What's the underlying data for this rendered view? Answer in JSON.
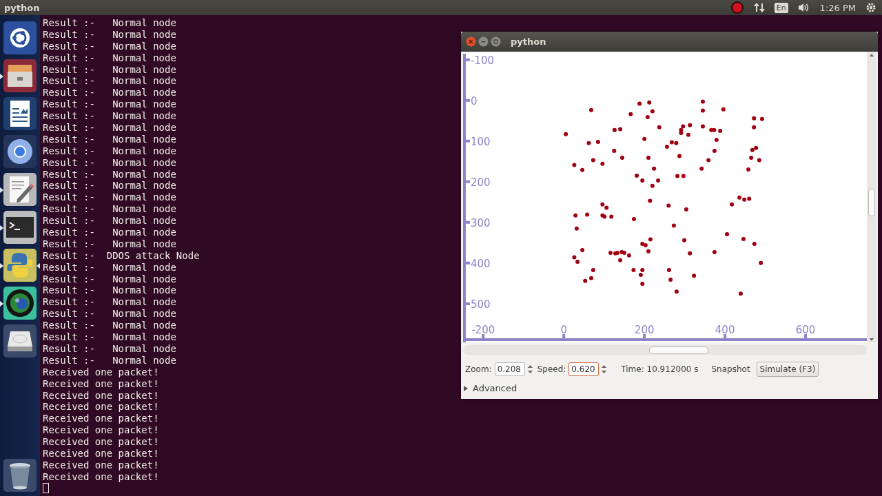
{
  "top_panel": {
    "app_title": "python",
    "keyboard_layout": "En",
    "clock": "1:26 PM"
  },
  "launcher": {
    "items": [
      {
        "kind": "dash",
        "running": false,
        "focused": false
      },
      {
        "kind": "files",
        "running": true,
        "focused": false
      },
      {
        "kind": "writer",
        "running": false,
        "focused": false
      },
      {
        "kind": "browser",
        "running": false,
        "focused": false
      },
      {
        "kind": "editor",
        "running": true,
        "focused": false
      },
      {
        "kind": "terminal",
        "running": true,
        "focused": false
      },
      {
        "kind": "python",
        "running": true,
        "focused": true
      },
      {
        "kind": "camera",
        "running": true,
        "focused": false
      },
      {
        "kind": "drive",
        "running": false,
        "focused": false
      },
      {
        "kind": "trash",
        "running": false,
        "focused": false
      }
    ]
  },
  "terminal": {
    "lines": [
      "Result :-   Normal node",
      "Result :-   Normal node",
      "Result :-   Normal node",
      "Result :-   Normal node",
      "Result :-   Normal node",
      "Result :-   Normal node",
      "Result :-   Normal node",
      "Result :-   Normal node",
      "Result :-   Normal node",
      "Result :-   Normal node",
      "Result :-   Normal node",
      "Result :-   Normal node",
      "Result :-   Normal node",
      "Result :-   Normal node",
      "Result :-   Normal node",
      "Result :-   Normal node",
      "Result :-   Normal node",
      "Result :-   Normal node",
      "Result :-   Normal node",
      "Result :-   Normal node",
      "Result :-  DDOS attack Node",
      "Result :-   Normal node",
      "Result :-   Normal node",
      "Result :-   Normal node",
      "Result :-   Normal node",
      "Result :-   Normal node",
      "Result :-   Normal node",
      "Result :-   Normal node",
      "Result :-   Normal node",
      "Result :-   Normal node",
      "Received one packet!",
      "Received one packet!",
      "Received one packet!",
      "Received one packet!",
      "Received one packet!",
      "Received one packet!",
      "Received one packet!",
      "Received one packet!",
      "Received one packet!",
      "Received one packet!"
    ],
    "cursor": true
  },
  "sim_window": {
    "title": "python",
    "canvas": {
      "chart_data": {
        "type": "scatter",
        "xlim": [
          -250,
          752
        ],
        "ylim": [
          595,
          -118
        ],
        "xticks": [
          -200,
          0,
          200,
          400,
          600
        ],
        "yticks": [
          -100,
          0,
          100,
          200,
          300,
          400,
          500
        ],
        "x": [
          5,
          68,
          62,
          85,
          26,
          46,
          73,
          96,
          126,
          140,
          125,
          145,
          166,
          188,
          212,
          208,
          220,
          237,
          200,
          210,
          224,
          234,
          195,
          181,
          220,
          256,
          268,
          279,
          296,
          291,
          291,
          313,
          309,
          287,
          282,
          297,
          345,
          345,
          345,
          366,
          373,
          388,
          379,
          396,
          374,
          359,
          342,
          472,
          472,
          492,
          477,
          468,
          465,
          485,
          458,
          436,
          448,
          460,
          417,
          304,
          214,
          260,
          174,
          96,
          106,
          96,
          29,
          58,
          101,
          118,
          32,
          273,
          299,
          405,
          446,
          473,
          489,
          374,
          313,
          215,
          195,
          203,
          210,
          144,
          150,
          133,
          116,
          128,
          162,
          140,
          46,
          26,
          34,
          73,
          53,
          68,
          173,
          195,
          191,
          195,
          261,
          265,
          280,
          323,
          439
        ],
        "series": [
          {
            "color": "#a00010",
            "values": [
              83,
              24,
              105,
              102,
              159,
              171,
              147,
              156,
              73,
              71,
              124,
              141,
              34,
              8,
              5,
              41,
              27,
              66,
              95,
              141,
              168,
              197,
              197,
              185,
              210,
              114,
              103,
              105,
              64,
              73,
              80,
              61,
              85,
              137,
              186,
              186,
              3,
              25,
              64,
              73,
              73,
              75,
              97,
              22,
              124,
              147,
              168,
              44,
              66,
              46,
              117,
              122,
              141,
              147,
              170,
              239,
              244,
              242,
              256,
              268,
              247,
              259,
              292,
              256,
              264,
              283,
              283,
              281,
              286,
              286,
              315,
              308,
              344,
              329,
              341,
              353,
              400,
              373,
              376,
              342,
              353,
              356,
              371,
              373,
              375,
              375,
              375,
              376,
              381,
              393,
              368,
              386,
              397,
              417,
              444,
              437,
              417,
              417,
              429,
              451,
              417,
              441,
              470,
              431,
              475
            ]
          }
        ]
      }
    },
    "controls": {
      "zoom_label": "Zoom:",
      "zoom_value": "0.208",
      "speed_label": "Speed:",
      "speed_value": "0.620",
      "speed_focused": true,
      "time": "Time: 10.912000 s",
      "snapshot": "Snapshot",
      "simulate": "Simulate (F3)",
      "advanced": "Advanced",
      "advanced_expanded": false
    }
  }
}
